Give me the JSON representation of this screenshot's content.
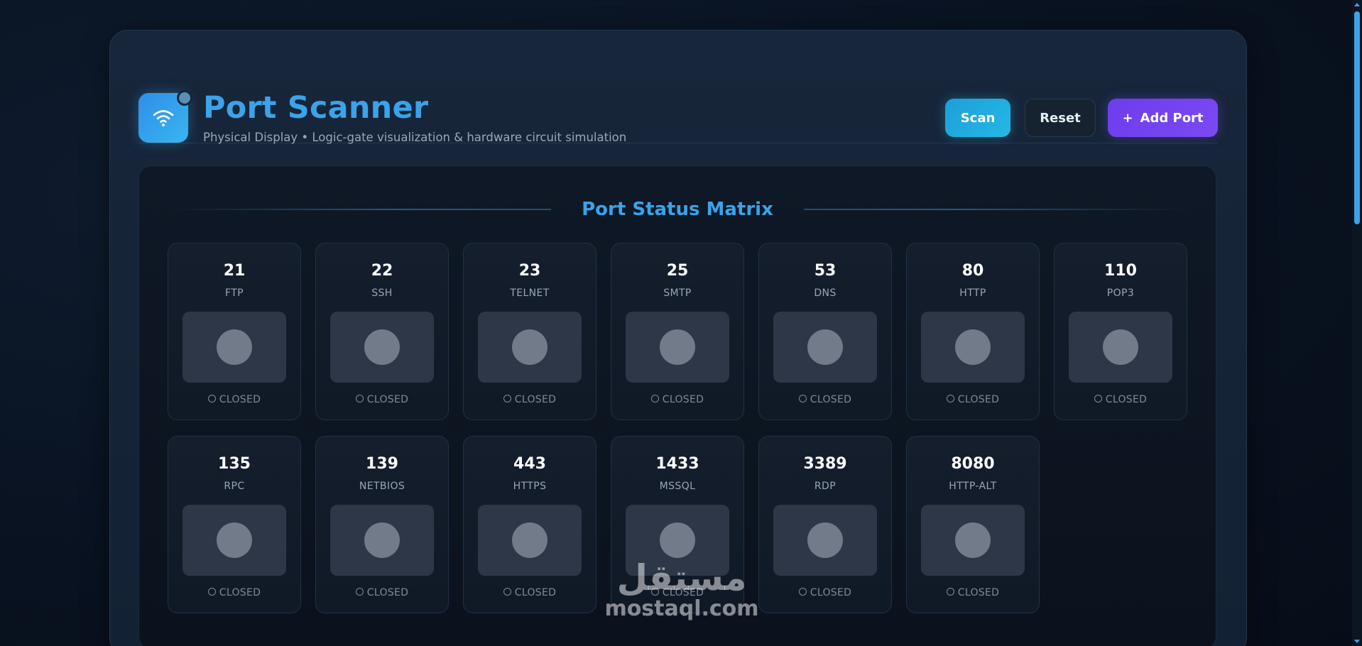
{
  "app": {
    "title": "Port Scanner",
    "subtitle": "Physical Display • Logic-gate visualization & hardware circuit simulation",
    "logo_icon": "wifi-icon"
  },
  "toolbar": {
    "scan_label": "Scan",
    "reset_label": "Reset",
    "add_label": "Add Port",
    "add_icon": "+"
  },
  "matrix": {
    "title": "Port Status Matrix",
    "ports": [
      {
        "port": "21",
        "service": "FTP",
        "status": "CLOSED"
      },
      {
        "port": "22",
        "service": "SSH",
        "status": "CLOSED"
      },
      {
        "port": "23",
        "service": "TELNET",
        "status": "CLOSED"
      },
      {
        "port": "25",
        "service": "SMTP",
        "status": "CLOSED"
      },
      {
        "port": "53",
        "service": "DNS",
        "status": "CLOSED"
      },
      {
        "port": "80",
        "service": "HTTP",
        "status": "CLOSED"
      },
      {
        "port": "110",
        "service": "POP3",
        "status": "CLOSED"
      },
      {
        "port": "135",
        "service": "RPC",
        "status": "CLOSED"
      },
      {
        "port": "139",
        "service": "NETBIOS",
        "status": "CLOSED"
      },
      {
        "port": "443",
        "service": "HTTPS",
        "status": "CLOSED"
      },
      {
        "port": "1433",
        "service": "MSSQL",
        "status": "CLOSED"
      },
      {
        "port": "3389",
        "service": "RDP",
        "status": "CLOSED"
      },
      {
        "port": "8080",
        "service": "HTTP-ALT",
        "status": "CLOSED"
      }
    ]
  },
  "watermark": {
    "arabic": "مستقل",
    "latin": "mostaql.com"
  },
  "colors": {
    "accent": "#3aa3ea",
    "scan_button": "#1d9fd8",
    "add_button": "#6d3cee",
    "closed_led": "#717b89"
  }
}
